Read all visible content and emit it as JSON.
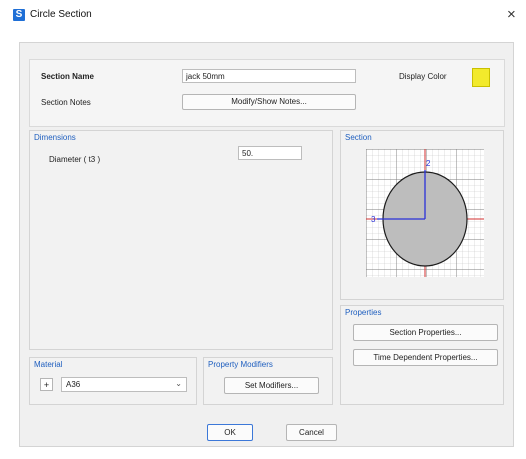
{
  "window": {
    "app_icon_letter": "S",
    "title": "Circle Section",
    "close_glyph": "×"
  },
  "section": {
    "name_label": "Section Name",
    "name_value": "jack 50mm",
    "notes_label": "Section Notes",
    "notes_button": "Modify/Show Notes...",
    "display_color_label": "Display Color",
    "display_color": "#f2ea2c"
  },
  "dimensions": {
    "title": "Dimensions",
    "diameter_label": "Diameter  ( t3 )",
    "diameter_value": "50."
  },
  "section_view": {
    "title": "Section",
    "axis_2_label": "2",
    "axis_3_label": "3"
  },
  "properties": {
    "title": "Properties",
    "section_properties_button": "Section Properties...",
    "time_dependent_button": "Time Dependent Properties..."
  },
  "material": {
    "title": "Material",
    "add_glyph": "+",
    "selected": "A36",
    "chevron_glyph": "⌄"
  },
  "property_modifiers": {
    "title": "Property Modifiers",
    "set_button": "Set Modifiers..."
  },
  "footer": {
    "ok": "OK",
    "cancel": "Cancel"
  }
}
